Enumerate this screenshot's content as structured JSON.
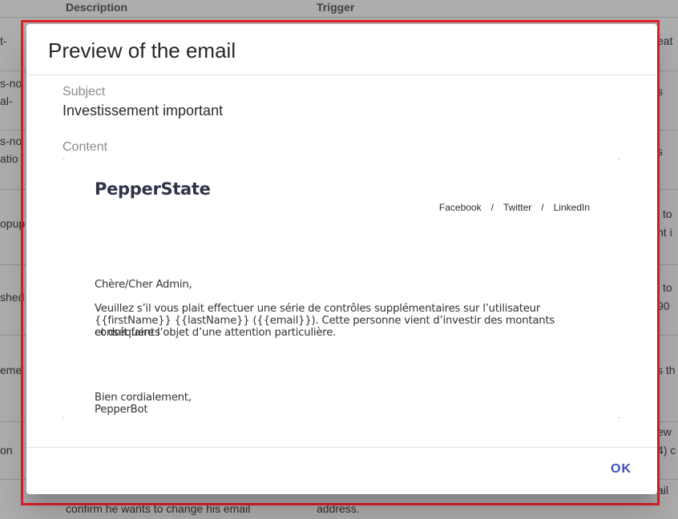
{
  "background_table": {
    "headers": {
      "description": "Description",
      "trigger": "Trigger"
    },
    "left_fragments": [
      "t-",
      "s-no",
      "al-",
      "s-no",
      "atio",
      "opup",
      "shed",
      "eme",
      "on"
    ],
    "right_fragments": [
      "eat",
      "s",
      "s",
      "l to",
      "nt i",
      "l to",
      "90",
      "s th",
      "ew",
      "4) c",
      "ail"
    ],
    "bottom_description": "confirm he wants to change his email",
    "bottom_trigger": "address."
  },
  "dialog": {
    "title": "Preview of the email",
    "subject_label": "Subject",
    "subject_value": "Investissement important",
    "content_label": "Content",
    "email": {
      "logo_text": "PepperState",
      "social_links": [
        "Facebook",
        "Twitter",
        "LinkedIn"
      ],
      "social_separator": "/",
      "greeting": "Chère/Cher Admin,",
      "body_line1": "Veuillez s’il vous plait effectuer une série de contrôles supplémentaires sur l’utilisateur",
      "body_line2": "{{firstName}} {{lastName}} ({{email}}). Cette personne vient d’investir des montants conséquents",
      "body_line3": "et doit faire l’objet d’une attention particulière.",
      "closing": "Bien cordialement,",
      "signature": "PepperBot"
    },
    "ok_label": "OK"
  },
  "colors": {
    "accent": "#3f51b5",
    "highlight_frame": "#e0202a",
    "overlay": "rgba(0,0,0,0.32)"
  }
}
